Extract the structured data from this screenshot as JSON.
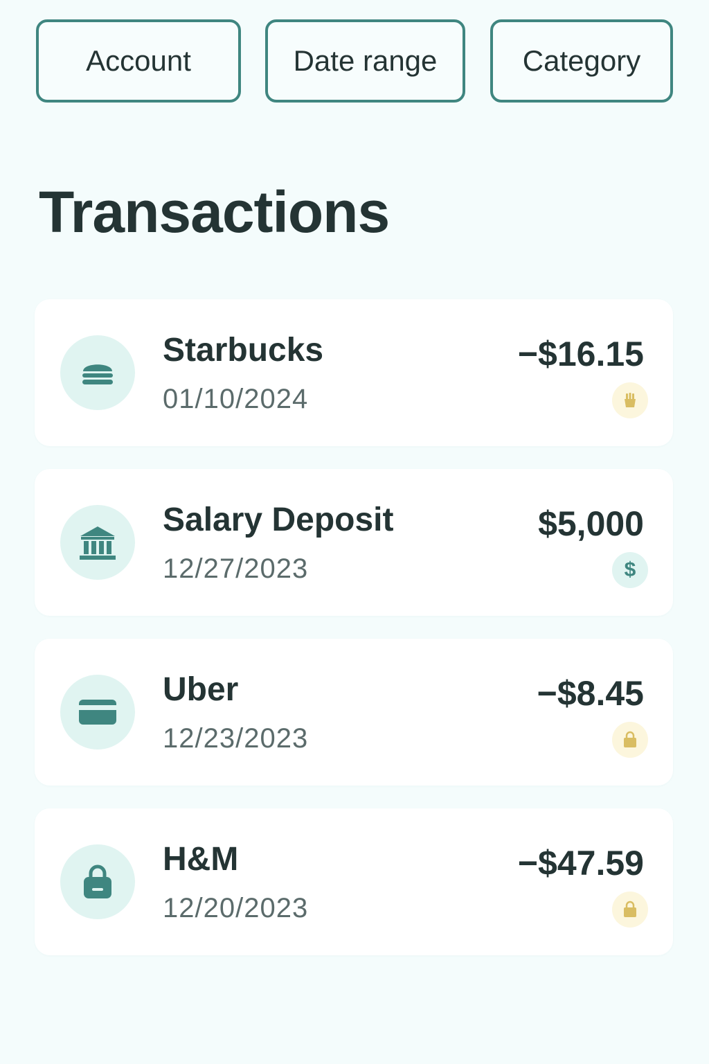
{
  "filters": {
    "account": "Account",
    "date_range": "Date range",
    "category": "Category"
  },
  "page_title": "Transactions",
  "transactions": [
    {
      "name": "Starbucks",
      "date": "01/10/2024",
      "amount": "−$16.15",
      "icon": "burger-icon",
      "badge_icon": "fries-icon"
    },
    {
      "name": "Salary Deposit",
      "date": "12/27/2023",
      "amount": "$5,000",
      "icon": "bank-icon",
      "badge_icon": "dollar-icon",
      "badge_text": "$"
    },
    {
      "name": "Uber",
      "date": "12/23/2023",
      "amount": "−$8.45",
      "icon": "credit-card-icon",
      "badge_icon": "shopping-bag-icon"
    },
    {
      "name": "H&M",
      "date": "12/20/2023",
      "amount": "−$47.59",
      "icon": "shopping-bag-icon",
      "badge_icon": "shopping-bag-icon"
    }
  ],
  "colors": {
    "accent": "#3f8680",
    "background": "#f4fcfc",
    "text": "#243434",
    "muted_text": "#5b6b6b",
    "icon_bg": "#e0f4f1",
    "badge_warm_bg": "#fcf6dd",
    "badge_warm_icon": "#d9bd62"
  }
}
